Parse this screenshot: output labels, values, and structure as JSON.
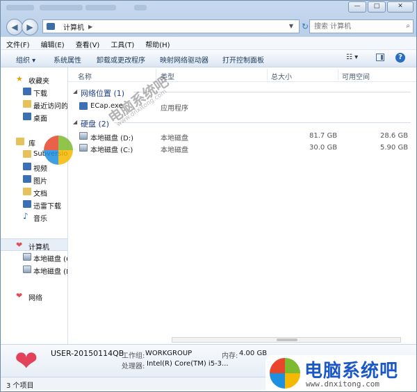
{
  "window": {
    "caption_buttons": [
      "—",
      "□",
      "✕"
    ]
  },
  "address": {
    "crumb": "计算机",
    "search_placeholder": "搜索 计算机"
  },
  "menu": [
    "文件(F)",
    "编辑(E)",
    "查看(V)",
    "工具(T)",
    "帮助(H)"
  ],
  "toolbar": {
    "organize": "组织 ▾",
    "system_properties": "系统属性",
    "uninstall": "卸载或更改程序",
    "map_drive": "映射网络驱动器",
    "control_panel": "打开控制面板",
    "view_icon": "☷ ▾"
  },
  "sidebar": {
    "favorites": "收藏夹",
    "fav_items": [
      "下载",
      "最近访问的",
      "桌面"
    ],
    "library": "库",
    "lib_items": [
      "Subversion",
      "视频",
      "图片",
      "文档",
      "迅雷下载",
      "音乐"
    ],
    "computer": "计算机",
    "computer_items": [
      "本地磁盘 (C",
      "本地磁盘 (D"
    ],
    "network": "网络"
  },
  "columns": [
    "名称",
    "类型",
    "总大小",
    "可用空间"
  ],
  "groups": {
    "network_locations": "网络位置 (1)",
    "hard_disks": "硬盘 (2)"
  },
  "rows": {
    "network": [
      {
        "name": "ECap.exe",
        "type": "应用程序",
        "total": "",
        "free": ""
      }
    ],
    "disks": [
      {
        "name": "本地磁盘 (D:)",
        "type": "本地磁盘",
        "total": "81.7 GB",
        "free": "28.6 GB"
      },
      {
        "name": "本地磁盘 (C:)",
        "type": "本地磁盘",
        "total": "30.0 GB",
        "free": "5.90 GB"
      }
    ]
  },
  "details": {
    "pc_name": "USER-20150114QB",
    "workgroup_label": "工作组:",
    "workgroup": "WORKGROUP",
    "memory_label": "内存:",
    "memory": "4.00 GB",
    "cpu_label": "处理器:",
    "cpu": "Intel(R) Core(TM) i5-3..."
  },
  "status": "3 个项目",
  "watermark": {
    "text": "电脑系统吧",
    "url": "www.dnxitong.com"
  },
  "colors": {
    "logo_red": "#e8452c",
    "logo_green": "#7dba2f",
    "logo_blue": "#1f8fe0",
    "logo_yellow": "#f6b800",
    "brand_blue": "#1a57c8"
  }
}
